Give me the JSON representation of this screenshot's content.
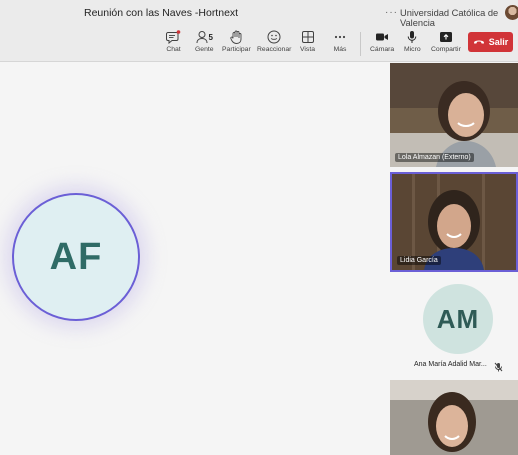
{
  "window": {
    "title": "Reunión con las Naves -Hortnext",
    "more_glyph": "···",
    "organization": "Universidad Católica de Valencia"
  },
  "toolbar": {
    "chat": "Chat",
    "people": "Gente",
    "people_count": "5",
    "raise": "Participar",
    "react": "Reaccionar",
    "view": "Vista",
    "more": "Más",
    "camera": "Cámara",
    "mic": "Micro",
    "share": "Compartir",
    "leave": "Salir"
  },
  "stage": {
    "main_avatar_initials": "AF",
    "participants": [
      {
        "name": "Lola Almazan (Externo)"
      },
      {
        "name": "Lidia García"
      },
      {
        "initials": "AM",
        "name": "Ana María Adalid Mar..."
      }
    ]
  },
  "colors": {
    "accent": "#6b5fd6",
    "leave_red": "#d13438",
    "avatar_text": "#2f6b66"
  }
}
